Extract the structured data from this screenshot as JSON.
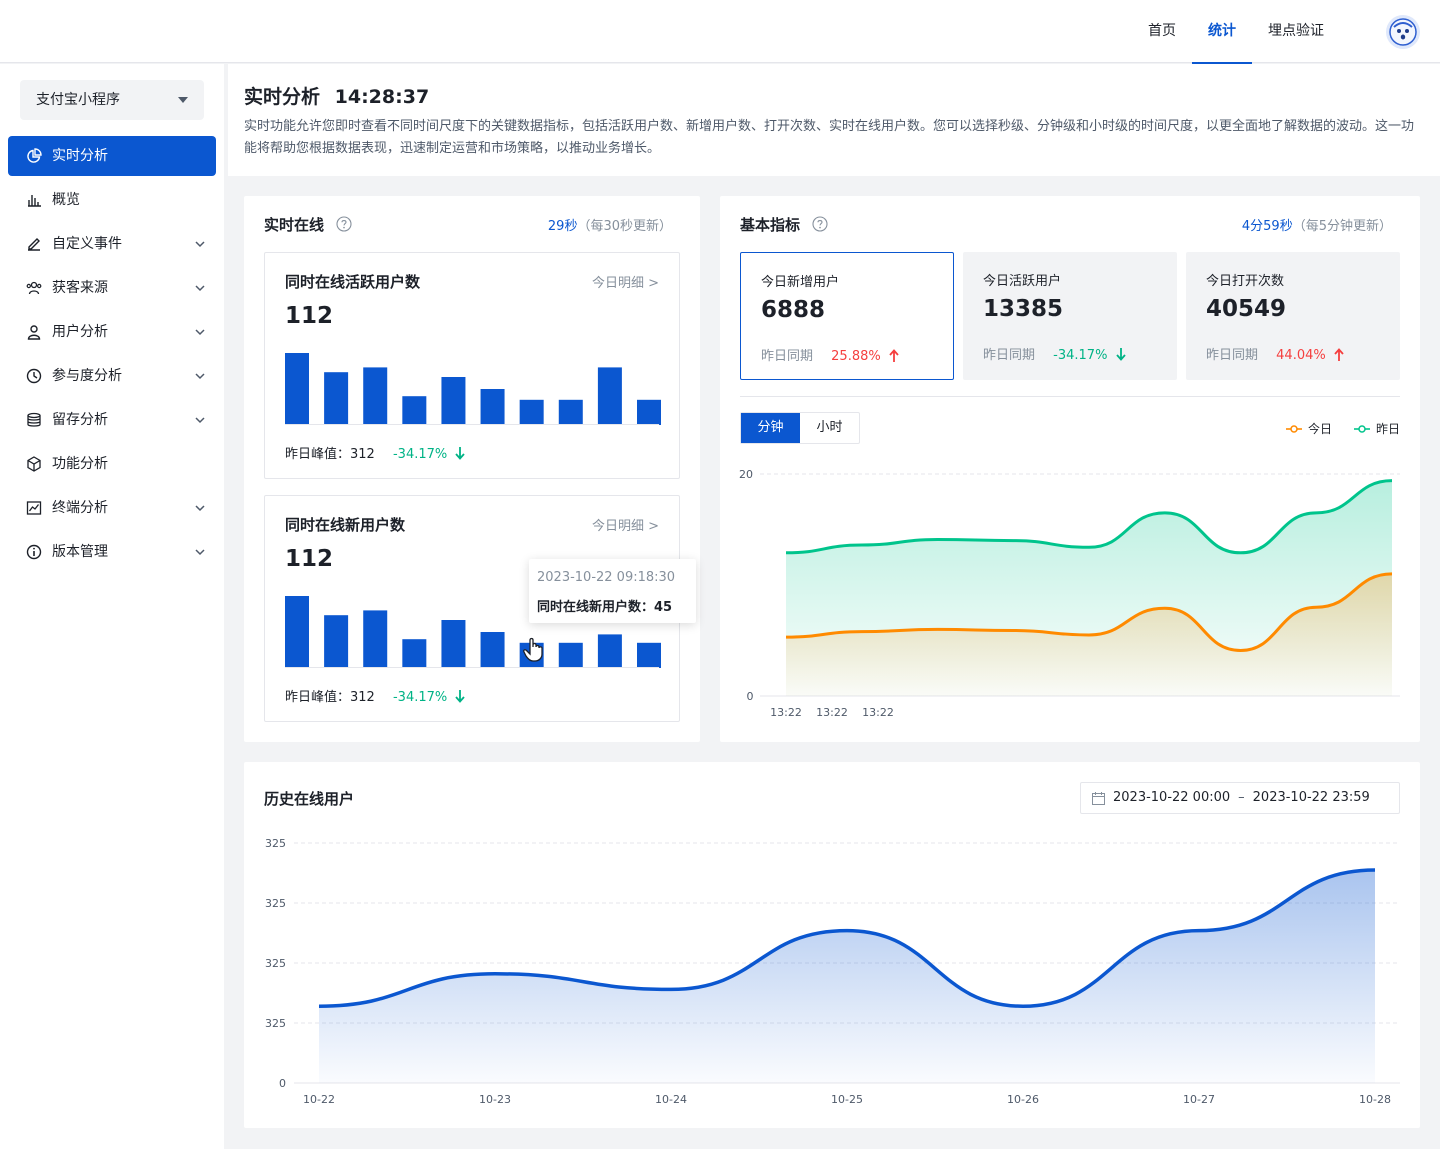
{
  "topnav": {
    "items": [
      "首页",
      "统计",
      "埋点验证"
    ],
    "active": "统计"
  },
  "sidebar": {
    "app_select": "支付宝小程序",
    "items": [
      {
        "label": "实时分析",
        "icon": "pie-chart-icon",
        "active": true
      },
      {
        "label": "概览",
        "icon": "bar-chart-icon"
      },
      {
        "label": "自定义事件",
        "icon": "edit-icon",
        "expandable": true
      },
      {
        "label": "获客来源",
        "icon": "users-icon",
        "expandable": true
      },
      {
        "label": "用户分析",
        "icon": "user-icon",
        "expandable": true
      },
      {
        "label": "参与度分析",
        "icon": "clock-icon",
        "expandable": true
      },
      {
        "label": "留存分析",
        "icon": "database-icon",
        "expandable": true
      },
      {
        "label": "功能分析",
        "icon": "cube-icon",
        "expandable": false
      },
      {
        "label": "终端分析",
        "icon": "line-chart-icon",
        "expandable": true
      },
      {
        "label": "版本管理",
        "icon": "info-icon",
        "expandable": true
      }
    ]
  },
  "header": {
    "title": "实时分析",
    "time": "14:28:37",
    "description": "实时功能允许您即时查看不同时间尺度下的关键数据指标，包括活跃用户数、新增用户数、打开次数、实时在线用户数。您可以选择秒级、分钟级和小时级的时间尺度，以更全面地了解数据的波动。这一功能将帮助您根据数据表现，迅速制定运营和市场策略，以推动业务增长。"
  },
  "realtime": {
    "title": "实时在线",
    "countdown": "29秒",
    "update_note": "（每30秒更新）",
    "cards": [
      {
        "title": "同时在线活跃用户数",
        "link": "今日明细 >",
        "value": "112",
        "peak_label": "昨日峰值：",
        "peak_value": "312",
        "change": "-34.17%",
        "bars": [
          60,
          44,
          48,
          24,
          40,
          30,
          21,
          21,
          48,
          21
        ]
      },
      {
        "title": "同时在线新用户数",
        "link": "今日明细 >",
        "value": "112",
        "peak_label": "昨日峰值：",
        "peak_value": "312",
        "change": "-34.17%",
        "bars": [
          60,
          44,
          48,
          24,
          40,
          30,
          21,
          21,
          28,
          21
        ]
      }
    ],
    "tooltip": {
      "time": "2023-10-22 09:18:30",
      "label": "同时在线新用户数：",
      "value": "45"
    }
  },
  "basic": {
    "title": "基本指标",
    "countdown": "4分59秒",
    "update_note": "（每5分钟更新）",
    "metrics": [
      {
        "label": "今日新增用户",
        "value": "6888",
        "compare": "昨日同期",
        "change": "25.88%",
        "dir": "up"
      },
      {
        "label": "今日活跃用户",
        "value": "13385",
        "compare": "昨日同期",
        "change": "-34.17%",
        "dir": "down"
      },
      {
        "label": "今日打开次数",
        "value": "40549",
        "compare": "昨日同期",
        "change": "44.04%",
        "dir": "up"
      }
    ],
    "tabs": [
      "分钟",
      "小时"
    ],
    "legend": [
      "今日",
      "昨日"
    ],
    "colors": {
      "today": "#ff8a00",
      "yesterday": "#00c48c"
    }
  },
  "history": {
    "title": "历史在线用户",
    "date_start": "2023-10-22 00:00",
    "date_sep": "–",
    "date_end": "2023-10-22 23:59"
  },
  "chart_data": [
    {
      "type": "area",
      "x": [
        "13:22",
        "13:22",
        "13:22"
      ],
      "ylim": [
        0,
        20
      ],
      "yticks": [
        "0",
        "20"
      ],
      "series": [
        {
          "name": "今日",
          "values": [
            5.3,
            5.8,
            6.0,
            5.9,
            5.5,
            7.9,
            4.1,
            8.0,
            11.0
          ]
        },
        {
          "name": "昨日",
          "values": [
            12.9,
            13.6,
            14.1,
            14.0,
            13.4,
            16.5,
            12.9,
            16.5,
            19.4
          ]
        }
      ]
    },
    {
      "type": "area",
      "title": "历史在线用户",
      "categories": [
        "10-22",
        "10-23",
        "10-24",
        "10-25",
        "10-26",
        "10-27",
        "10-28"
      ],
      "yticks": [
        "0",
        "325",
        "325",
        "325",
        "325"
      ],
      "series": [
        {
          "values": [
            1.28,
            1.82,
            1.56,
            2.54,
            1.28,
            2.54,
            3.55
          ]
        }
      ]
    }
  ]
}
